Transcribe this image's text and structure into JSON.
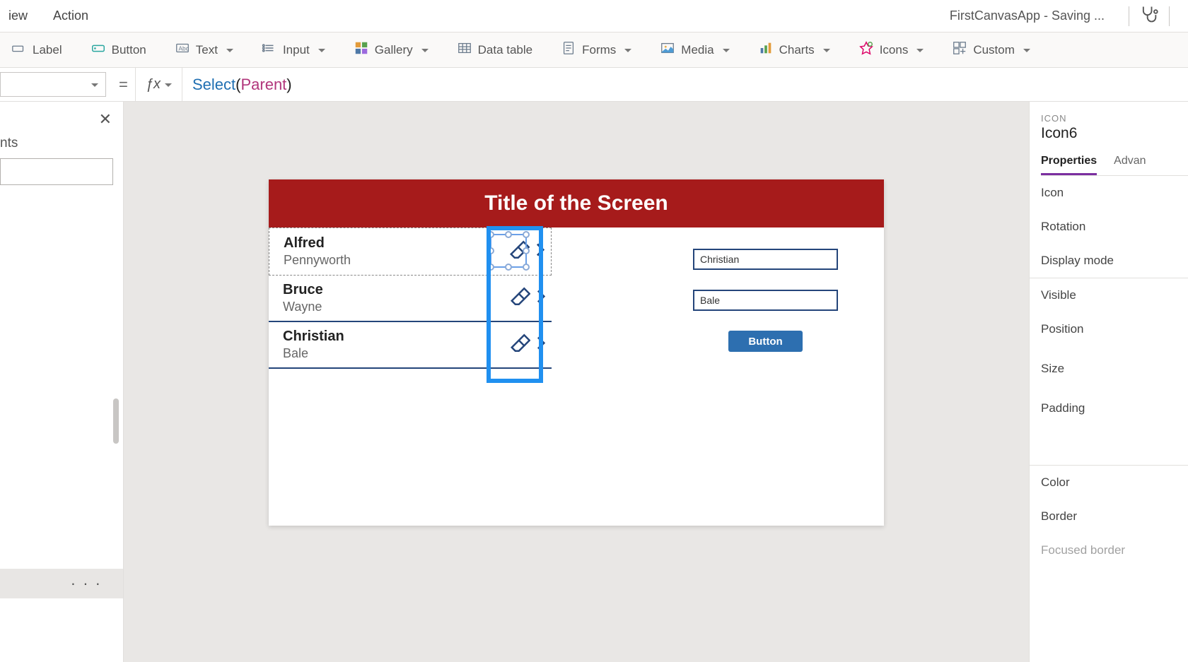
{
  "menubar": {
    "items": [
      "iew",
      "Action"
    ],
    "doc_title": "FirstCanvasApp - Saving ..."
  },
  "ribbon": {
    "label_btn": "Label",
    "button_btn": "Button",
    "text": "Text",
    "input": "Input",
    "gallery": "Gallery",
    "datatable": "Data table",
    "forms": "Forms",
    "media": "Media",
    "charts": "Charts",
    "icons": "Icons",
    "custom": "Custom"
  },
  "formula": {
    "fn": "Select",
    "arg": "Parent",
    "eq": "="
  },
  "leftpane": {
    "header": "nts",
    "more": "· · ·"
  },
  "screen": {
    "title": "Title of the Screen",
    "gallery": [
      {
        "first": "Alfred",
        "last": "Pennyworth"
      },
      {
        "first": "Bruce",
        "last": "Wayne"
      },
      {
        "first": "Christian",
        "last": "Bale"
      }
    ],
    "form": {
      "field1": "Christian",
      "field2": "Bale",
      "button": "Button"
    }
  },
  "rightpane": {
    "ctl_type": "ICON",
    "ctl_name": "Icon6",
    "tabs": {
      "properties": "Properties",
      "advanced": "Advan"
    },
    "props": {
      "icon": "Icon",
      "rotation": "Rotation",
      "display_mode": "Display mode",
      "visible": "Visible",
      "position": "Position",
      "size": "Size",
      "padding": "Padding",
      "color": "Color",
      "border": "Border",
      "focused_border": "Focused border"
    }
  }
}
